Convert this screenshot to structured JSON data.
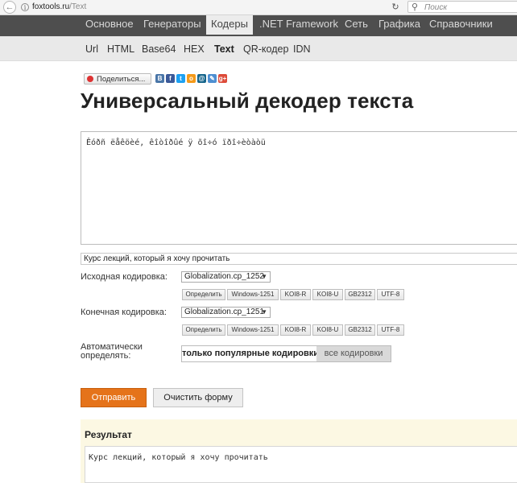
{
  "browser": {
    "url_host": "foxtools.ru",
    "url_path": "/Text",
    "search_placeholder": "Поиск"
  },
  "top_nav": {
    "items": [
      {
        "label": "Основное"
      },
      {
        "label": "Генераторы"
      },
      {
        "label": "Кодеры"
      },
      {
        "label": ".NET Framework"
      },
      {
        "label": "Сеть"
      },
      {
        "label": "Графика"
      },
      {
        "label": "Справочники"
      }
    ],
    "active": "Кодеры"
  },
  "sub_nav": {
    "items": [
      {
        "label": "Url"
      },
      {
        "label": "HTML"
      },
      {
        "label": "Base64"
      },
      {
        "label": "HEX"
      },
      {
        "label": "Text"
      },
      {
        "label": "QR-кодер"
      },
      {
        "label": "IDN"
      }
    ],
    "active": "Text"
  },
  "share": {
    "label": "Поделиться...",
    "networks": [
      "vkontakte-icon",
      "facebook-icon",
      "twitter-icon",
      "odnoklassniki-icon",
      "moimir-icon",
      "livejournal-icon",
      "googleplus-icon"
    ],
    "colors": [
      "#4a76a8",
      "#3b5998",
      "#1da1f2",
      "#f59a1a",
      "#16658b",
      "#4e8fd1",
      "#dd4b39"
    ],
    "glyphs": [
      "В",
      "f",
      "t",
      "о",
      "@",
      "✎",
      "g+"
    ]
  },
  "page_title": "Универсальный декодер текста",
  "input_text": "Êóðñ ëåêöèé, êîòîðûé ÿ õî÷ó ïðî÷èòàòü",
  "decoded_preview": "Курс лекций, который я хочу прочитать",
  "source_encoding": {
    "label": "Исходная кодировка:",
    "selected": "Globalization.cp_1252"
  },
  "target_encoding": {
    "label": "Конечная кодировка:",
    "selected": "Globalization.cp_1251"
  },
  "encoding_buttons": [
    "Определить",
    "Windows-1251",
    "KOI8-R",
    "KOI8-U",
    "GB2312",
    "UTF-8"
  ],
  "auto_detect": {
    "label_line1": "Автоматически",
    "label_line2": "определять:",
    "option_popular": "только популярные кодировки",
    "option_all": "все кодировки"
  },
  "submit_label": "Отправить",
  "clear_label": "Очистить форму",
  "result": {
    "title": "Результат",
    "text": "Курс лекций, который я хочу прочитать"
  }
}
